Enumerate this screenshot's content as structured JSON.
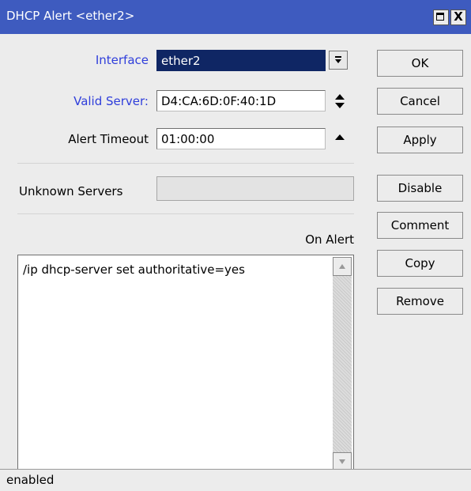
{
  "window": {
    "title": "DHCP Alert <ether2>",
    "titlebar_color": "#3e5bbf",
    "close_glyph": "X"
  },
  "form": {
    "interface": {
      "label": "Interface",
      "value": "ether2"
    },
    "valid_server": {
      "label": "Valid Server:",
      "value": "D4:CA:6D:0F:40:1D"
    },
    "alert_timeout": {
      "label": "Alert Timeout",
      "value": "01:00:00"
    },
    "unknown_servers": {
      "label": "Unknown Servers",
      "value": ""
    },
    "on_alert": {
      "label": "On Alert",
      "value": "/ip dhcp-server set authoritative=yes"
    }
  },
  "buttons": {
    "ok": "OK",
    "cancel": "Cancel",
    "apply": "Apply",
    "disable": "Disable",
    "comment": "Comment",
    "copy": "Copy",
    "remove": "Remove"
  },
  "icons": {
    "dropdown": "dropdown-arrow-icon",
    "updown": "up-down-arrows-icon",
    "up": "up-arrow-icon"
  },
  "status": {
    "text": "enabled"
  }
}
